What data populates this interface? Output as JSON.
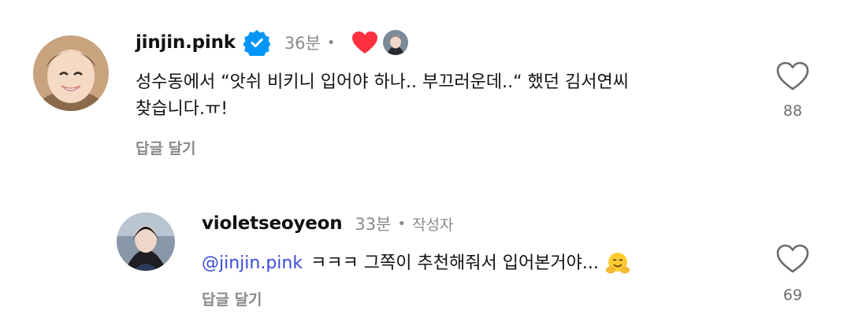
{
  "comments": [
    {
      "username": "jinjin.pink",
      "time": "36분",
      "dot": "•",
      "text_line1": "성수동에서 “앗쉬 비키니 입어야 하나.. 부끄러운데..“ 했던 김서연씨",
      "text_line2": "찾습니다.ㅠ!",
      "reply_label": "답글 달기",
      "likes": "88",
      "verified_icon": "verified-badge-icon",
      "liked_by_creator_icon": "red-heart-icon"
    },
    {
      "username": "violetseoyeon",
      "time": "33분",
      "dot": "•",
      "author_label": "작성자",
      "mention": "@jinjin.pink",
      "text": "ㅋㅋㅋ 그쪽이 추천해줘서 입어본거야...",
      "emoji_icon": "hugging-face-emoji",
      "reply_label": "답글 달기",
      "likes": "69"
    }
  ],
  "colors": {
    "verified_blue": "#0095f6",
    "heart_red": "#ff3040",
    "mention_blue": "#3b4bd8",
    "muted_gray": "#8a8a8a"
  }
}
